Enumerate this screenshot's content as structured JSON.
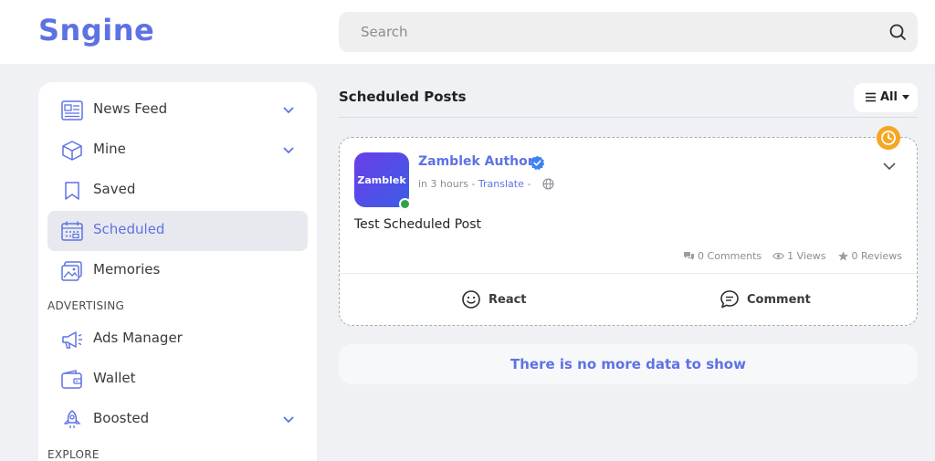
{
  "header": {
    "logo": "Sngine",
    "search_placeholder": "Search"
  },
  "sidebar": {
    "items": [
      {
        "label": "News Feed",
        "icon": "newspaper-icon"
      },
      {
        "label": "Mine",
        "icon": "cube-icon"
      },
      {
        "label": "Saved",
        "icon": "bookmark-icon"
      },
      {
        "label": "Scheduled",
        "icon": "calendar-icon",
        "active": true
      },
      {
        "label": "Memories",
        "icon": "photos-icon"
      }
    ],
    "advertising_title": "ADVERTISING",
    "advertising_items": [
      {
        "label": "Ads Manager",
        "icon": "megaphone-icon"
      },
      {
        "label": "Wallet",
        "icon": "wallet-icon"
      },
      {
        "label": "Boosted",
        "icon": "rocket-icon"
      }
    ],
    "explore_title": "EXPLORE"
  },
  "main": {
    "title": "Scheduled Posts",
    "filter_label": "All",
    "post": {
      "author": "Zamblek Author",
      "avatar_text": "Zamblek",
      "time": "in 3 hours",
      "translate": "Translate",
      "text": "Test Scheduled Post",
      "comments": "0 Comments",
      "views": "1 Views",
      "reviews": "0 Reviews",
      "react_label": "React",
      "comment_label": "Comment"
    },
    "no_more": "There is no more data to show"
  },
  "colors": {
    "accent": "#5e72e4",
    "badge": "#f5a623",
    "online": "#31a24c"
  }
}
